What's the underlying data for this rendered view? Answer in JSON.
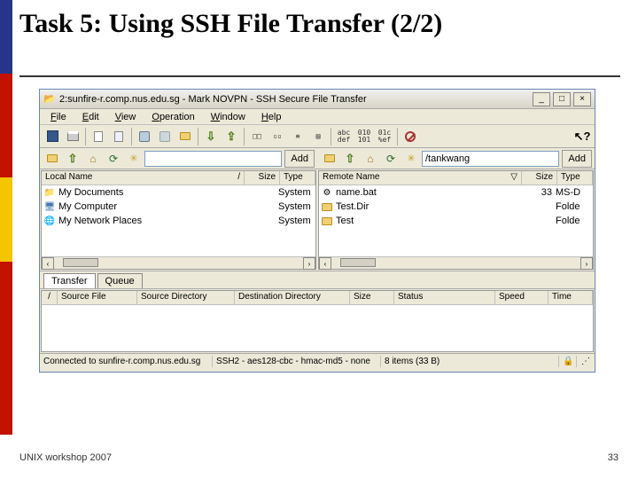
{
  "slide": {
    "title": "Task 5: Using SSH File Transfer (2/2)",
    "footer_left": "UNIX workshop 2007",
    "footer_right": "33"
  },
  "window": {
    "title": "2:sunfire-r.comp.nus.edu.sg - Mark NOVPN - SSH Secure File Transfer",
    "menu": {
      "file": "File",
      "edit": "Edit",
      "view": "View",
      "operation": "Operation",
      "window": "Window",
      "help": "Help"
    },
    "toolbar_text": {
      "abc": "abc\ndef",
      "bin1": "010\n101",
      "bin2": "01c\n%ef"
    },
    "locbar": {
      "add": "Add",
      "remote_path": "/tankwang"
    },
    "local": {
      "header_name": "Local Name",
      "header_size": "Size",
      "header_type": "Type",
      "rows": [
        {
          "name": "My Documents",
          "size": "",
          "type": "System"
        },
        {
          "name": "My Computer",
          "size": "",
          "type": "System"
        },
        {
          "name": "My Network Places",
          "size": "",
          "type": "System"
        }
      ]
    },
    "remote": {
      "header_name": "Remote Name",
      "header_size": "Size",
      "header_type": "Type",
      "rows": [
        {
          "name": "name.bat",
          "size": "33",
          "type": "MS-D"
        },
        {
          "name": "Test.Dir",
          "size": "",
          "type": "Folde"
        },
        {
          "name": "Test",
          "size": "",
          "type": "Folde"
        }
      ]
    },
    "tabs": {
      "transfer": "Transfer",
      "queue": "Queue"
    },
    "transfer": {
      "c1": "/",
      "c2": "Source File",
      "c3": "Source Directory",
      "c4": "Destination Directory",
      "c5": "Size",
      "c6": "Status",
      "c7": "Speed",
      "c8": "Time"
    },
    "status": {
      "connected": "Connected to sunfire-r.comp.nus.edu.sg",
      "cipher": "SSH2 - aes128-cbc - hmac-md5 - none",
      "items": "8 items (33 B)"
    },
    "icons": {
      "title": "📂",
      "sort": "/",
      "sort2": "▽",
      "left": "‹",
      "right": "›",
      "arrow_up": "⇪",
      "arrow_dn": "⇩",
      "home": "⌂",
      "folder_plus": "✳"
    }
  }
}
